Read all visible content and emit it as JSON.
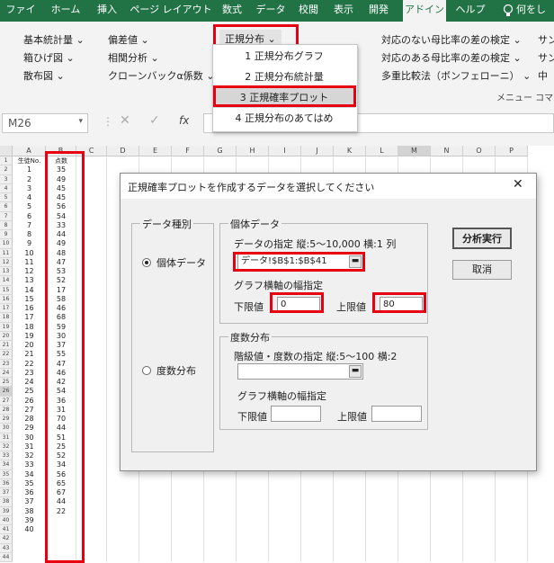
{
  "tabs": [
    "ファイル",
    "ホーム",
    "挿入",
    "ページ レイアウト",
    "数式",
    "データ",
    "校閲",
    "表示",
    "開発",
    "アドイン",
    "ヘルプ",
    "何をし"
  ],
  "active_tab": "アドイン",
  "ribbon": {
    "col1": [
      "基本統計量 ⌄",
      "箱ひげ図 ⌄",
      "散布図 ⌄"
    ],
    "col2": [
      "偏差値 ⌄",
      "相関分析 ⌄",
      "クローンバックα係数 ⌄"
    ],
    "dist_button": "正規分布 ⌄",
    "col4": [
      "対応のない母比率の差の検定 ⌄",
      "対応のある母比率の差の検定 ⌄",
      "多重比較法（ボンフェローニ） ⌄"
    ],
    "col5": [
      "サン",
      "サン",
      "中"
    ],
    "group_label": "メニュー コマン"
  },
  "menu": {
    "items": [
      "1 正規分布グラフ",
      "2 正規分布統計量",
      "3 正規確率プロット",
      "4 正規分布のあてはめ"
    ]
  },
  "formula": {
    "namebox": "M26",
    "fx": "fx"
  },
  "grid": {
    "columns": [
      "A",
      "B",
      "C",
      "D",
      "E",
      "F",
      "G",
      "H",
      "I",
      "J",
      "K",
      "L",
      "M",
      "N",
      "O",
      "P"
    ],
    "header_a": "生徒No.",
    "header_b": "点数",
    "student_no": [
      "1",
      "2",
      "3",
      "4",
      "5",
      "6",
      "7",
      "8",
      "9",
      "10",
      "11",
      "12",
      "13",
      "14",
      "15",
      "16",
      "17",
      "18",
      "19",
      "20",
      "21",
      "22",
      "23",
      "24",
      "25",
      "26",
      "27",
      "28",
      "29",
      "30",
      "31",
      "32",
      "33",
      "34",
      "35",
      "36",
      "37",
      "38",
      "39",
      "40"
    ],
    "scores": [
      "35",
      "49",
      "45",
      "45",
      "56",
      "54",
      "33",
      "44",
      "49",
      "48",
      "47",
      "53",
      "52",
      "17",
      "58",
      "46",
      "68",
      "59",
      "30",
      "37",
      "55",
      "47",
      "46",
      "42",
      "54",
      "36",
      "31",
      "70",
      "44",
      "51",
      "25",
      "52",
      "34",
      "56",
      "65",
      "67",
      "44",
      "22"
    ]
  },
  "dialog": {
    "title": "正規確率プロットを作成するデータを選択してください",
    "close": "✕",
    "data_type_group": "データ種別",
    "radio_individual": "個体データ",
    "radio_freq": "度数分布",
    "individual_group": "個体データ",
    "data_spec": "データの指定  縦:5〜10,000  横:1 列",
    "data_range": "データ!$B$1:$B$41",
    "graph_axis": "グラフ横軸の幅指定",
    "lower_label": "下限値",
    "lower_value": "0",
    "upper_label": "上限値",
    "upper_value": "80",
    "freq_group": "度数分布",
    "freq_spec": "階級値・度数の指定  縦:5〜100  横:2",
    "freq_axis": "グラフ横軸の幅指定",
    "freq_lower_label": "下限値",
    "freq_upper_label": "上限値",
    "run_button": "分析実行",
    "cancel_button": "取消"
  }
}
